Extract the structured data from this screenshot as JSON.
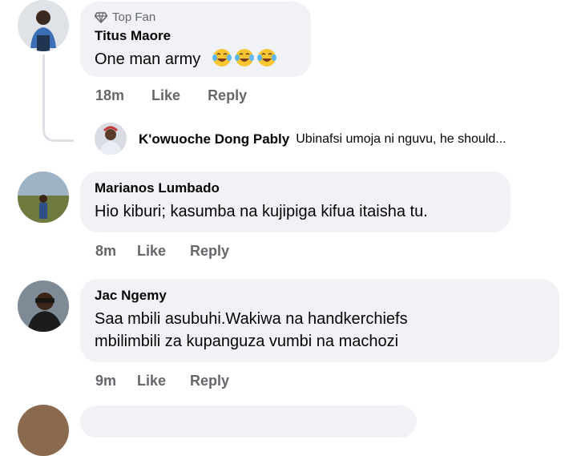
{
  "comments": [
    {
      "badge": "Top Fan",
      "name": "Titus Maore",
      "text": "One man army",
      "emoji": [
        "crying-laughing-face-emoji",
        "crying-laughing-face-emoji",
        "crying-laughing-face-emoji"
      ],
      "time": "18m",
      "like": "Like",
      "reply": "Reply"
    },
    {
      "name": "Marianos Lumbado",
      "text": "Hio kiburi; kasumba na kujipiga kifua itaisha tu.",
      "time": "8m",
      "like": "Like",
      "reply": "Reply"
    },
    {
      "name": "Jac Ngemy",
      "text_line1": "Saa mbili asubuhi.Wakiwa na handkerchiefs",
      "text_line2": "mbilimbili za kupanguza vumbi na machozi",
      "time": "9m",
      "like": "Like",
      "reply": "Reply"
    }
  ],
  "reply_preview": {
    "name": "K'owuoche Dong Pably",
    "text": "Ubinafsi umoja ni nguvu, he should..."
  },
  "colors": {
    "bubble": "#f0f2f5",
    "meta_text": "#65676b",
    "text": "#050505"
  }
}
